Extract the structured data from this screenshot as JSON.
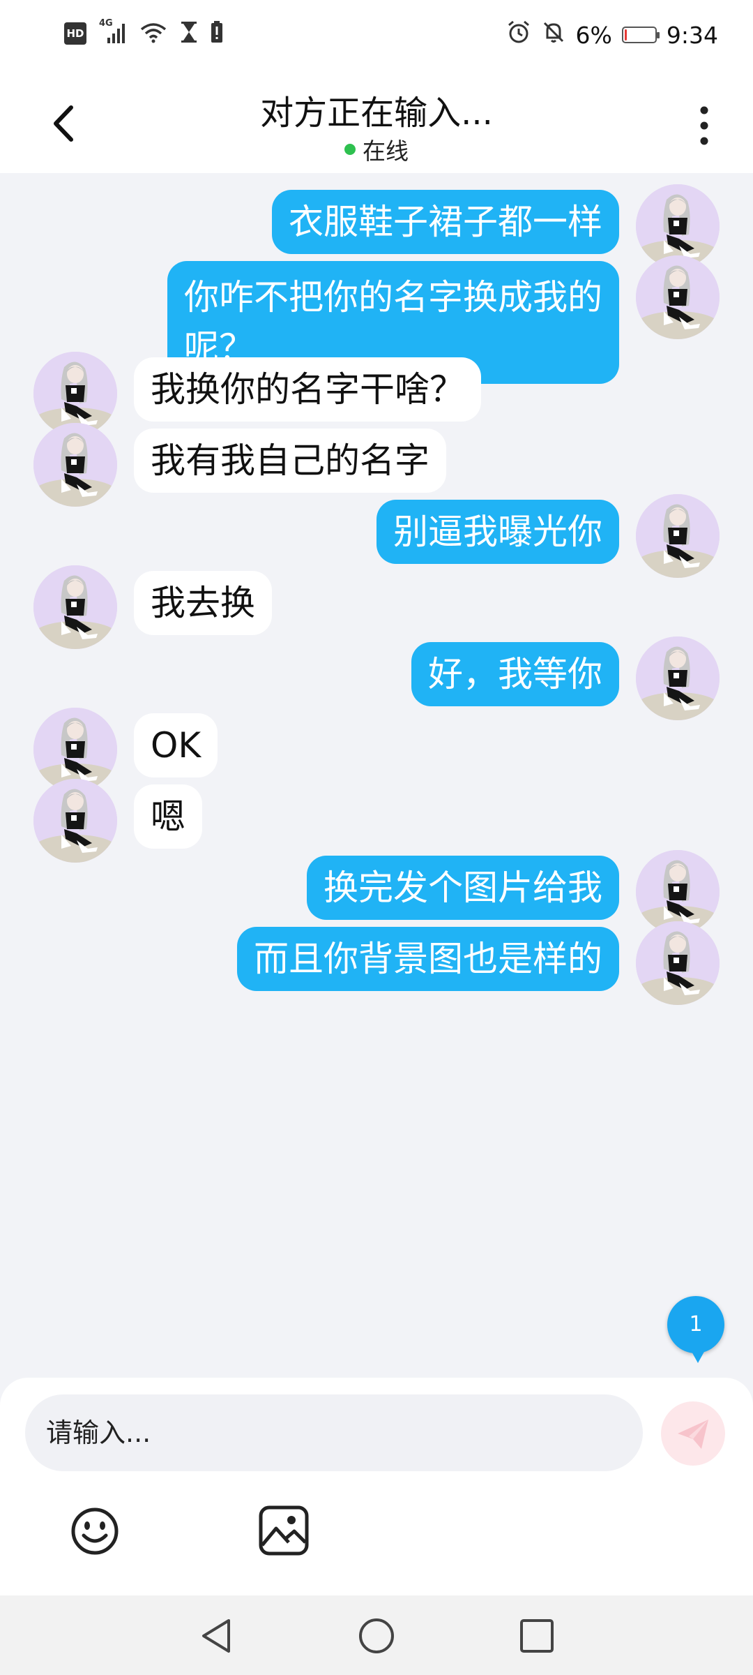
{
  "status_bar": {
    "hd_label": "HD",
    "network_label": "4G",
    "battery_text": "6%",
    "battery_level": 0.06,
    "time": "9:34"
  },
  "header": {
    "title": "对方正在输入...",
    "status": "在线",
    "status_color": "#2ec04f"
  },
  "messages": [
    {
      "side": "out",
      "text": "衣服鞋子裙子都一样"
    },
    {
      "side": "out",
      "text": "你咋不把你的名字换成我的",
      "text2": "呢？"
    },
    {
      "side": "in",
      "text": "我换你的名字干啥？"
    },
    {
      "side": "in",
      "text": "我有我自己的名字"
    },
    {
      "side": "out",
      "text": "别逼我曝光你"
    },
    {
      "side": "in",
      "text": "我去换"
    },
    {
      "side": "out",
      "text": "好，我等你"
    },
    {
      "side": "in",
      "text": "OK"
    },
    {
      "side": "in",
      "text": "嗯"
    },
    {
      "side": "out",
      "text": "换完发个图片给我"
    },
    {
      "side": "out",
      "text": "而且你背景图也是样的"
    }
  ],
  "unread_count": "1",
  "composer": {
    "placeholder": "请输入...",
    "send_icon": "paper-plane-icon",
    "emoji_icon": "smiley-icon",
    "image_icon": "picture-icon"
  },
  "colors": {
    "outgoing_bubble": "#20b3f5",
    "incoming_bubble": "#ffffff",
    "chat_background": "#f2f3f7",
    "unread_badge": "#1aa6f0"
  }
}
